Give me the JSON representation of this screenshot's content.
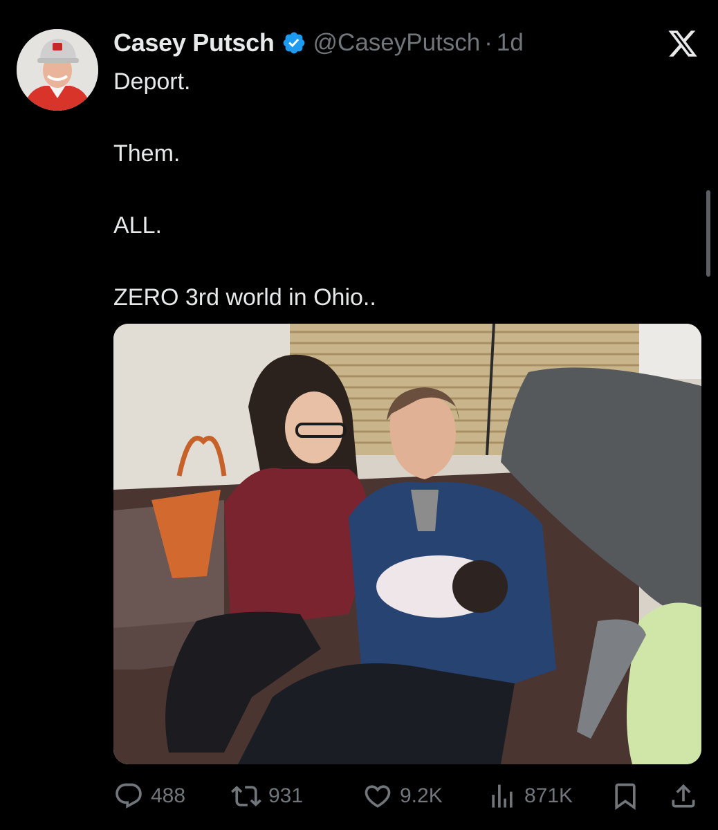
{
  "post": {
    "author_name": "Casey Putsch",
    "handle": "@CaseyPutsch",
    "separator": "·",
    "age": "1d",
    "verified": true,
    "lines": [
      "Deport.",
      "Them.",
      "ALL.",
      "ZERO 3rd world in Ohio.."
    ]
  },
  "stats": {
    "replies": "488",
    "reposts": "931",
    "likes": "9.2K",
    "views": "871K"
  },
  "icons": {
    "close": "x-logo-icon",
    "verified": "verified-badge-icon",
    "reply": "reply-icon",
    "repost": "repost-icon",
    "like": "heart-icon",
    "views": "views-icon",
    "bookmark": "bookmark-icon",
    "share": "share-icon"
  },
  "colors": {
    "background": "#000000",
    "text_primary": "#e7e9ea",
    "text_secondary": "#71767b",
    "verified_blue": "#1d9bf0"
  }
}
